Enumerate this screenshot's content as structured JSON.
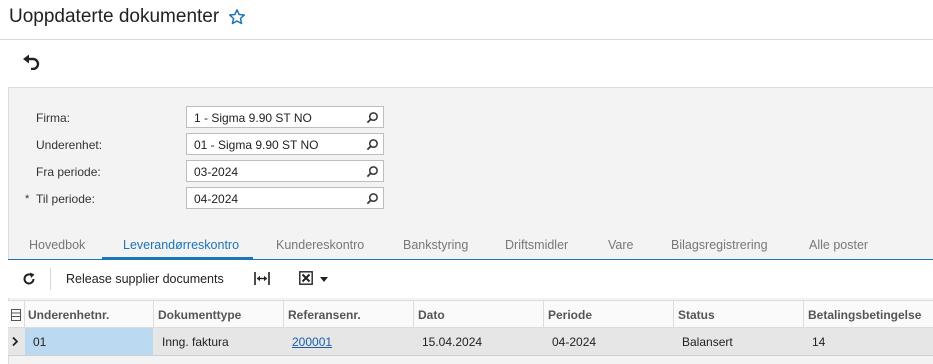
{
  "header": {
    "title": "Uoppdaterte dokumenter"
  },
  "filters": [
    {
      "label": "Firma:",
      "value": "1 - Sigma 9.90 ST NO",
      "required": false
    },
    {
      "label": "Underenhet:",
      "value": "01 - Sigma 9.90 ST NO",
      "required": false
    },
    {
      "label": "Fra periode:",
      "value": "03-2024",
      "required": false
    },
    {
      "label": "Til periode:",
      "value": "04-2024",
      "required": true,
      "required_mark": "*"
    }
  ],
  "tabs": [
    {
      "label": "Hovedbok",
      "active": false
    },
    {
      "label": "Leverandørreskontro",
      "active": true
    },
    {
      "label": "Kundereskontro",
      "active": false
    },
    {
      "label": "Bankstyring",
      "active": false
    },
    {
      "label": "Driftsmidler",
      "active": false
    },
    {
      "label": "Vare",
      "active": false
    },
    {
      "label": "Bilagsregistrering",
      "active": false
    },
    {
      "label": "Alle poster",
      "active": false
    }
  ],
  "toolbar": {
    "release_label": "Release supplier documents"
  },
  "grid": {
    "columns": [
      "Underenhetnr.",
      "Dokumenttype",
      "Referansenr.",
      "Dato",
      "Periode",
      "Status",
      "Betalingsbetingelse"
    ],
    "rows": [
      [
        "01",
        "Inng. faktura",
        "200001",
        "15.04.2024",
        "04-2024",
        "Balansert",
        "14"
      ]
    ]
  },
  "icons": [
    "star-icon",
    "undo-icon",
    "search-icon",
    "refresh-icon",
    "fit-columns-icon",
    "excel-export-icon",
    "caret-down-icon",
    "row-selector-icon",
    "column-settings-icon"
  ],
  "colors": {
    "accent": "#1b75bb",
    "link": "#1b5faa",
    "selected_cell": "#bcd9f2",
    "panel_bg": "#f3f3f3"
  }
}
